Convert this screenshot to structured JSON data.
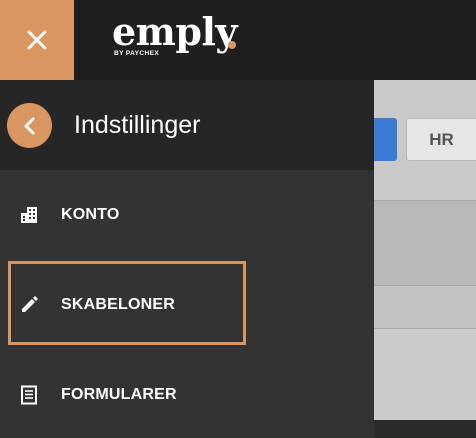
{
  "header": {
    "close_icon": "close-icon",
    "logo": {
      "word": "emply",
      "sub": "BY PAYCHEX",
      "dot_color": "#d99660"
    },
    "accent_color": "#d99660"
  },
  "background": {
    "hr_button_label": "HR",
    "primary_button_color": "#3a7bd5"
  },
  "panel": {
    "back_icon": "chevron-left-icon",
    "title": "Indstillinger",
    "items": [
      {
        "label": "KONTO",
        "icon": "building-icon"
      },
      {
        "label": "SKABELONER",
        "icon": "pencil-icon",
        "highlighted": true
      },
      {
        "label": "FORMULARER",
        "icon": "form-icon"
      }
    ]
  }
}
